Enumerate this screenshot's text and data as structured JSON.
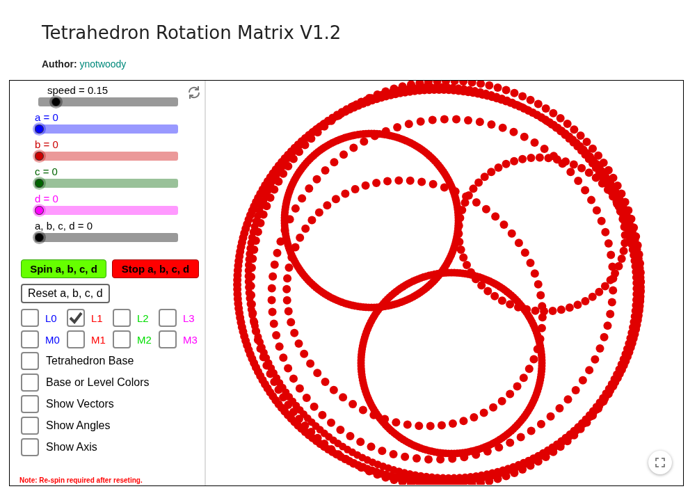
{
  "page": {
    "title": "Tetrahedron Rotation Matrix V1.2",
    "author_label": "Author:",
    "author": "ynotwoody"
  },
  "sliders": [
    {
      "label": "speed = 0.15",
      "level": 0.1,
      "color": "#000000"
    },
    {
      "label": "a = 0",
      "level": 0,
      "color": "#0000ff"
    },
    {
      "label": "b = 0",
      "level": 0,
      "color": "#cc0000"
    },
    {
      "label": "c = 0",
      "level": 0,
      "color": "#006400"
    },
    {
      "label": "d = 0",
      "level": 0,
      "color": "#ff00ff"
    },
    {
      "label": "a, b, c, d = 0",
      "level": 0,
      "color": "#000000"
    }
  ],
  "buttons": [
    {
      "label": "Spin a, b, c, d",
      "kind": "spin"
    },
    {
      "label": "Stop a, b, c, d",
      "kind": "stop"
    },
    {
      "label": "Reset a, b, c, d",
      "kind": "plain"
    }
  ],
  "level_checkboxes": [
    {
      "label": "L0",
      "checked": false,
      "color": "#0000ff"
    },
    {
      "label": "L1",
      "checked": true,
      "color": "#ff0000"
    },
    {
      "label": "L2",
      "checked": false,
      "color": "#00dd00"
    },
    {
      "label": "L3",
      "checked": false,
      "color": "#ff00ff"
    },
    {
      "label": "M0",
      "checked": false,
      "color": "#0000ff"
    },
    {
      "label": "M1",
      "checked": false,
      "color": "#ff0000"
    },
    {
      "label": "M2",
      "checked": false,
      "color": "#00dd00"
    },
    {
      "label": "M3",
      "checked": false,
      "color": "#ff00ff"
    }
  ],
  "option_checkboxes": [
    {
      "label": "Tetrahedron Base",
      "checked": false
    },
    {
      "label": "Base or Level Colors",
      "checked": false
    },
    {
      "label": "Show Vectors",
      "checked": false
    },
    {
      "label": "Show Angles",
      "checked": false
    },
    {
      "label": "Show Axis",
      "checked": false
    }
  ],
  "note": "Note: Re-spin required after reseting."
}
